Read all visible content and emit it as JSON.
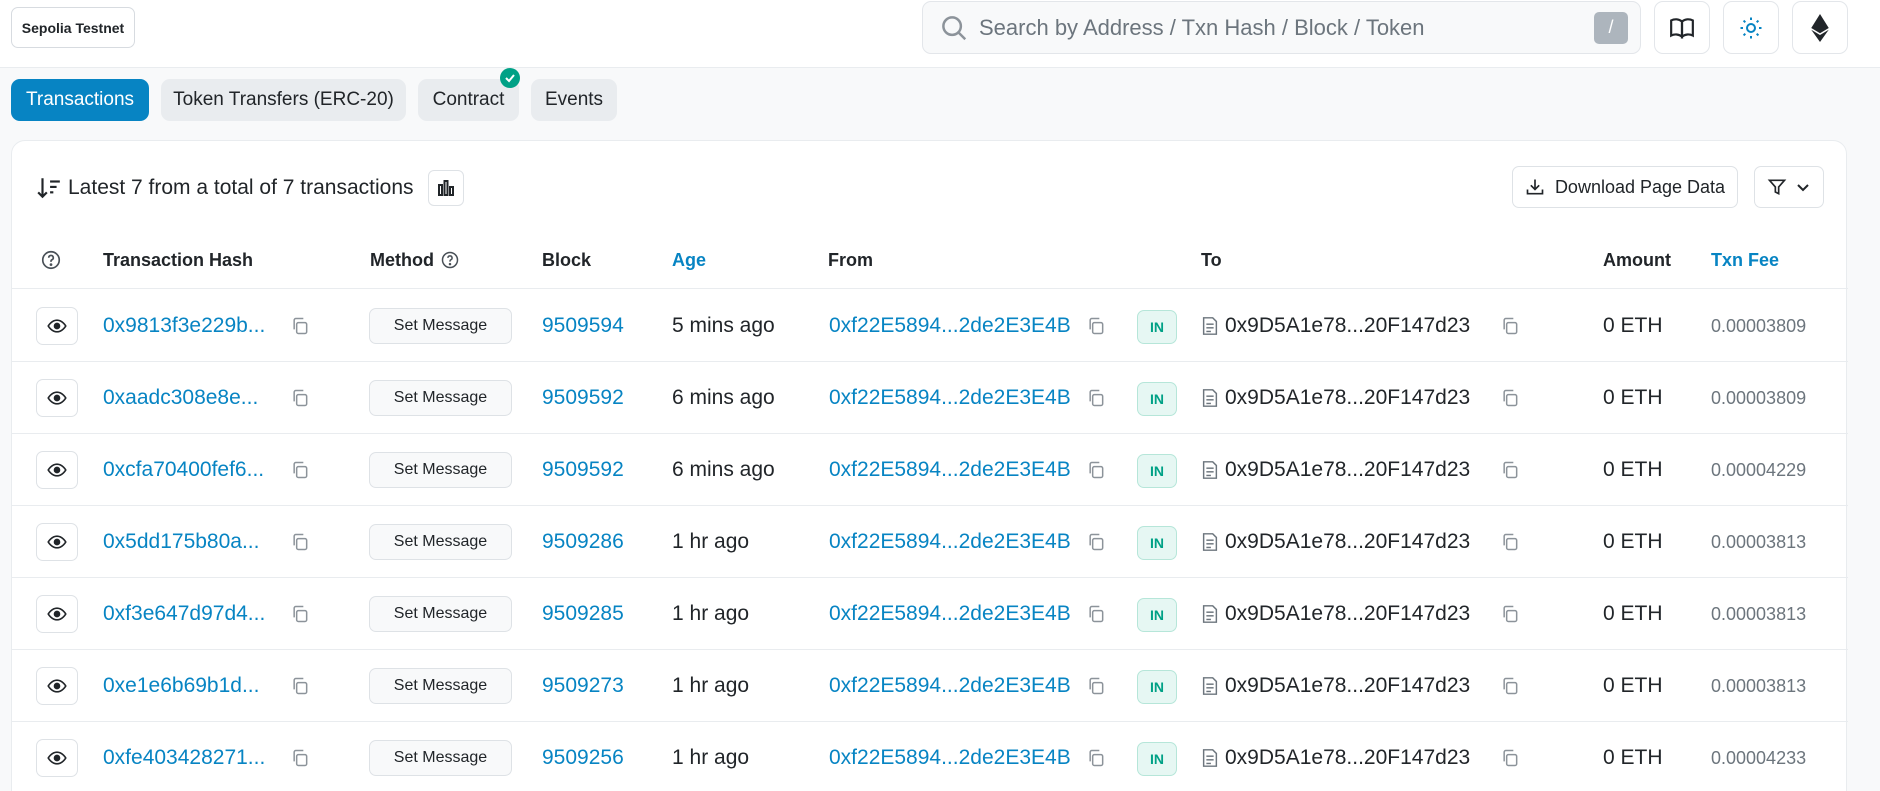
{
  "network": "Sepolia Testnet",
  "search": {
    "placeholder": "Search by Address / Txn Hash / Block / Token",
    "shortcut": "/"
  },
  "tabs": [
    {
      "label": "Transactions",
      "active": true
    },
    {
      "label": "Token Transfers (ERC-20)",
      "active": false
    },
    {
      "label": "Contract",
      "active": false,
      "verified": true
    },
    {
      "label": "Events",
      "active": false
    }
  ],
  "summary": "Latest 7 from a total of 7 transactions",
  "download_label": "Download Page Data",
  "columns": {
    "hash": "Transaction Hash",
    "method": "Method",
    "block": "Block",
    "age": "Age",
    "from": "From",
    "to": "To",
    "amount": "Amount",
    "fee": "Txn Fee"
  },
  "rows": [
    {
      "hash": "0x9813f3e229b...",
      "method": "Set Message",
      "block": "9509594",
      "age": "5 mins ago",
      "from": "0xf22E5894...2de2E3E4B",
      "direction": "IN",
      "to": "0x9D5A1e78...20F147d23",
      "amount": "0 ETH",
      "fee": "0.00003809"
    },
    {
      "hash": "0xaadc308e8e...",
      "method": "Set Message",
      "block": "9509592",
      "age": "6 mins ago",
      "from": "0xf22E5894...2de2E3E4B",
      "direction": "IN",
      "to": "0x9D5A1e78...20F147d23",
      "amount": "0 ETH",
      "fee": "0.00003809"
    },
    {
      "hash": "0xcfa70400fef6...",
      "method": "Set Message",
      "block": "9509592",
      "age": "6 mins ago",
      "from": "0xf22E5894...2de2E3E4B",
      "direction": "IN",
      "to": "0x9D5A1e78...20F147d23",
      "amount": "0 ETH",
      "fee": "0.00004229"
    },
    {
      "hash": "0x5dd175b80a...",
      "method": "Set Message",
      "block": "9509286",
      "age": "1 hr ago",
      "from": "0xf22E5894...2de2E3E4B",
      "direction": "IN",
      "to": "0x9D5A1e78...20F147d23",
      "amount": "0 ETH",
      "fee": "0.00003813"
    },
    {
      "hash": "0xf3e647d97d4...",
      "method": "Set Message",
      "block": "9509285",
      "age": "1 hr ago",
      "from": "0xf22E5894...2de2E3E4B",
      "direction": "IN",
      "to": "0x9D5A1e78...20F147d23",
      "amount": "0 ETH",
      "fee": "0.00003813"
    },
    {
      "hash": "0xe1e6b69b1d...",
      "method": "Set Message",
      "block": "9509273",
      "age": "1 hr ago",
      "from": "0xf22E5894...2de2E3E4B",
      "direction": "IN",
      "to": "0x9D5A1e78...20F147d23",
      "amount": "0 ETH",
      "fee": "0.00003813"
    },
    {
      "hash": "0xfe403428271...",
      "method": "Set Message",
      "block": "9509256",
      "age": "1 hr ago",
      "from": "0xf22E5894...2de2E3E4B",
      "direction": "IN",
      "to": "0x9D5A1e78...20F147d23",
      "amount": "0 ETH",
      "fee": "0.00004233"
    }
  ],
  "colors": {
    "accent": "#0784c3",
    "success": "#00a186",
    "muted": "#6c757d"
  }
}
